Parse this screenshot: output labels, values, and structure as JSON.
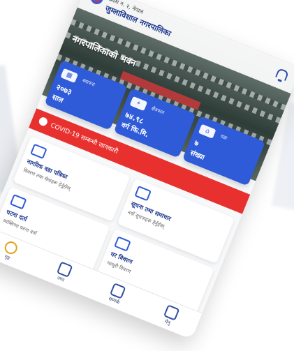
{
  "header": {
    "line1": "प्रदेश न. २, नेपाल",
    "title": "जुम्लाविशाल नगरपालिका"
  },
  "hero": {
    "caption": "नगरपालिकाको भवन"
  },
  "stats": [
    {
      "icon": "calendar-icon",
      "label": "स्थापना",
      "value": "२०७३",
      "sub": "साल"
    },
    {
      "icon": "map-icon",
      "label": "क्षेत्रफल",
      "value": "७४.९८",
      "sub": "वर्ग कि.मि."
    },
    {
      "icon": "ward-icon",
      "label": "वडा",
      "value": "७",
      "sub": "संख्या"
    }
  ],
  "covid_banner": {
    "text": "COVID-19 सम्बन्धी जानकारी"
  },
  "cards": [
    {
      "icon": "building-icon",
      "title": "नागरिक वडा पत्रिका",
      "desc": "विवरण तथा सेवाहरू हेर्नुहोस्"
    },
    {
      "icon": "document-icon",
      "title": "सूचना तथा समाचार",
      "desc": "नयाँ सूचनाहरू हेर्नुहोस्"
    },
    {
      "icon": "tag-icon",
      "title": "घटना दर्ता",
      "desc": "व्यक्तिगत घटना दर्ता"
    },
    {
      "icon": "home-icon",
      "title": "घर विवरण",
      "desc": "घरधुरी विवरण"
    }
  ],
  "nav": [
    {
      "icon": "home-icon",
      "label": "गृह"
    },
    {
      "icon": "globe-icon",
      "label": "नगर"
    },
    {
      "icon": "phone-icon",
      "label": "सम्पर्क"
    },
    {
      "icon": "menu-icon",
      "label": "मेनु"
    }
  ]
}
